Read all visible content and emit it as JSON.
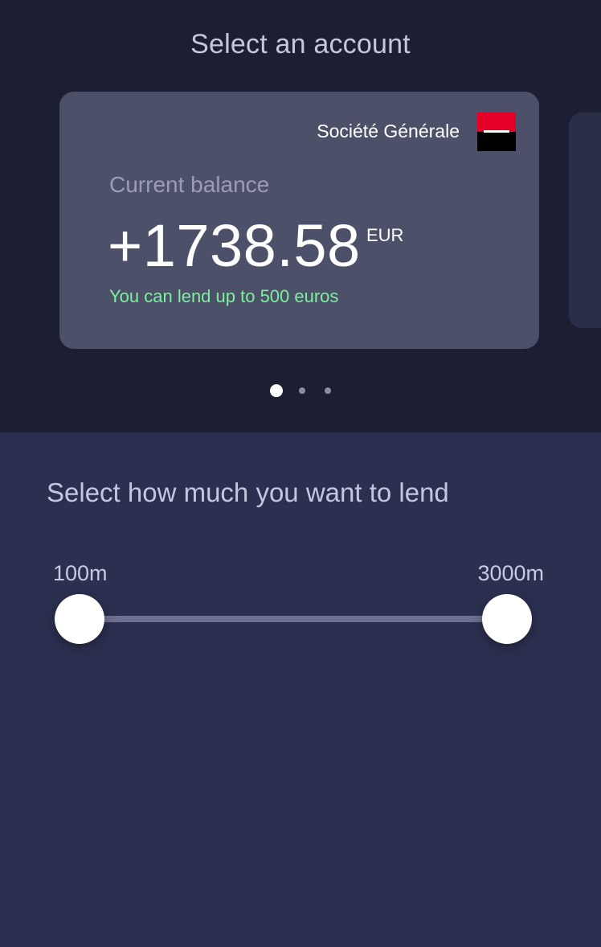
{
  "header": {
    "title": "Select an account"
  },
  "account_card": {
    "bank_name": "Société Générale",
    "bank_logo_icon": "societe-generale-logo",
    "balance_label": "Current balance",
    "balance_amount": "+1738.58",
    "currency": "EUR",
    "lend_note": "You can lend up to 500 euros",
    "colors": {
      "card_background": "#4d5069",
      "lend_note": "#7cf09e",
      "logo_red": "#e60028",
      "logo_black": "#000000"
    }
  },
  "pagination": {
    "total": 3,
    "active_index": 0
  },
  "lend_section": {
    "title": "Select how much you want to lend",
    "range_min_label": "100m",
    "range_max_label": "3000m",
    "slider": {
      "min": 100,
      "max": 3000,
      "low_value": 100,
      "high_value": 3000
    }
  }
}
